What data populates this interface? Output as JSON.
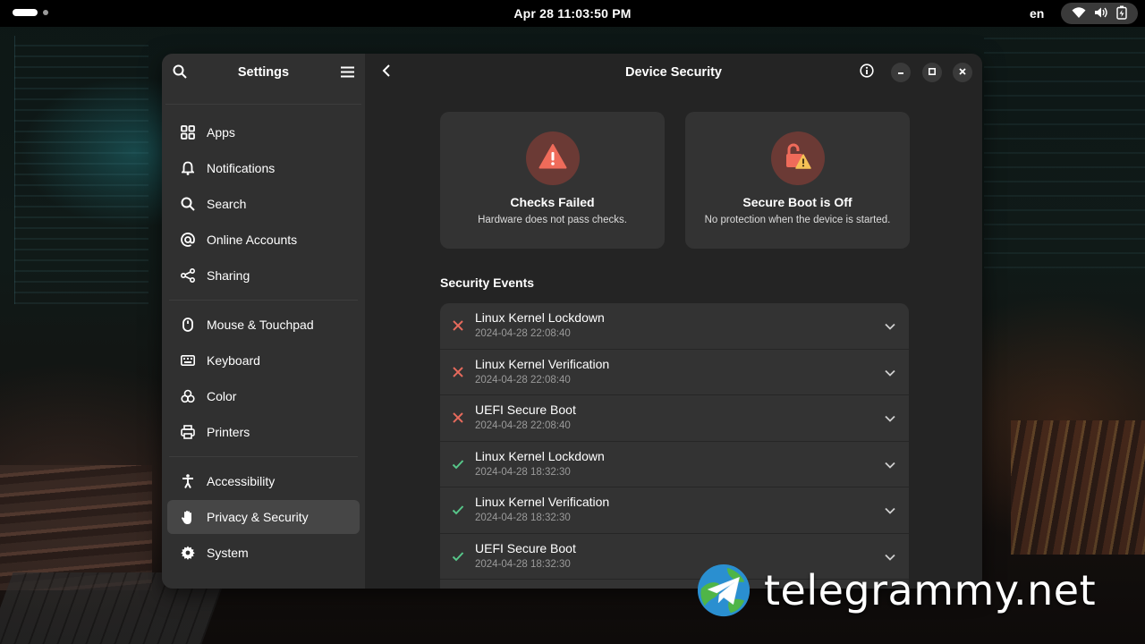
{
  "topbar": {
    "clock": "Apr 28  11:03:50 PM",
    "language": "en",
    "status_icons": [
      "wifi-icon",
      "volume-icon",
      "battery-icon"
    ]
  },
  "sidebar": {
    "title": "Settings",
    "groups": [
      [
        {
          "label": "Apps",
          "icon": "apps-grid-icon"
        },
        {
          "label": "Notifications",
          "icon": "bell-icon"
        },
        {
          "label": "Search",
          "icon": "search-icon"
        },
        {
          "label": "Online Accounts",
          "icon": "at-icon"
        },
        {
          "label": "Sharing",
          "icon": "share-icon"
        }
      ],
      [
        {
          "label": "Mouse & Touchpad",
          "icon": "mouse-icon"
        },
        {
          "label": "Keyboard",
          "icon": "keyboard-icon"
        },
        {
          "label": "Color",
          "icon": "color-icon"
        },
        {
          "label": "Printers",
          "icon": "printer-icon"
        }
      ],
      [
        {
          "label": "Accessibility",
          "icon": "accessibility-icon"
        },
        {
          "label": "Privacy & Security",
          "icon": "hand-icon",
          "active": true
        },
        {
          "label": "System",
          "icon": "gear-icon"
        }
      ]
    ]
  },
  "content": {
    "title": "Device Security",
    "cards": [
      {
        "title": "Checks Failed",
        "subtitle": "Hardware does not pass checks.",
        "icon": "warning-icon"
      },
      {
        "title": "Secure Boot is Off",
        "subtitle": "No protection when the device is started.",
        "icon": "unlocked-padlock-icon"
      }
    ],
    "events_title": "Security Events",
    "events": [
      {
        "name": "Linux Kernel Lockdown",
        "time": "2024-04-28 22:08:40",
        "status": "failed"
      },
      {
        "name": "Linux Kernel Verification",
        "time": "2024-04-28 22:08:40",
        "status": "failed"
      },
      {
        "name": "UEFI Secure Boot",
        "time": "2024-04-28 22:08:40",
        "status": "failed"
      },
      {
        "name": "Linux Kernel Lockdown",
        "time": "2024-04-28 18:32:30",
        "status": "passed"
      },
      {
        "name": "Linux Kernel Verification",
        "time": "2024-04-28 18:32:30",
        "status": "passed"
      },
      {
        "name": "UEFI Secure Boot",
        "time": "2024-04-28 18:32:30",
        "status": "passed"
      }
    ]
  },
  "watermark": {
    "text": "telegrammy.net"
  },
  "colors": {
    "fail": "#e66a5c",
    "pass": "#57c78a",
    "warning_fill": "#ef6b5a",
    "lock_fill": "#f5c156",
    "accent_bg": "#6b3a35"
  }
}
